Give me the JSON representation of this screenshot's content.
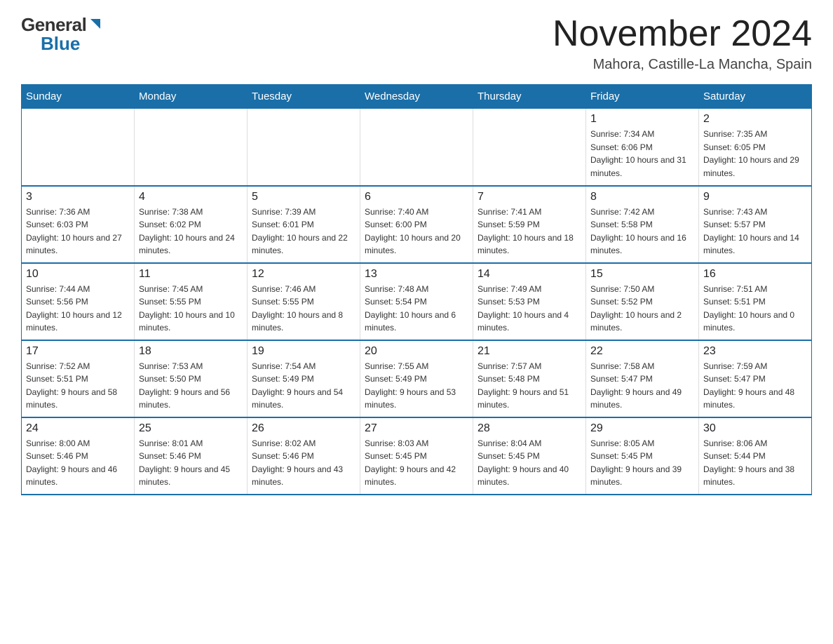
{
  "header": {
    "logo_general": "General",
    "logo_blue": "Blue",
    "month_title": "November 2024",
    "location": "Mahora, Castille-La Mancha, Spain"
  },
  "weekdays": [
    "Sunday",
    "Monday",
    "Tuesday",
    "Wednesday",
    "Thursday",
    "Friday",
    "Saturday"
  ],
  "weeks": [
    [
      {
        "day": "",
        "info": ""
      },
      {
        "day": "",
        "info": ""
      },
      {
        "day": "",
        "info": ""
      },
      {
        "day": "",
        "info": ""
      },
      {
        "day": "",
        "info": ""
      },
      {
        "day": "1",
        "info": "Sunrise: 7:34 AM\nSunset: 6:06 PM\nDaylight: 10 hours and 31 minutes."
      },
      {
        "day": "2",
        "info": "Sunrise: 7:35 AM\nSunset: 6:05 PM\nDaylight: 10 hours and 29 minutes."
      }
    ],
    [
      {
        "day": "3",
        "info": "Sunrise: 7:36 AM\nSunset: 6:03 PM\nDaylight: 10 hours and 27 minutes."
      },
      {
        "day": "4",
        "info": "Sunrise: 7:38 AM\nSunset: 6:02 PM\nDaylight: 10 hours and 24 minutes."
      },
      {
        "day": "5",
        "info": "Sunrise: 7:39 AM\nSunset: 6:01 PM\nDaylight: 10 hours and 22 minutes."
      },
      {
        "day": "6",
        "info": "Sunrise: 7:40 AM\nSunset: 6:00 PM\nDaylight: 10 hours and 20 minutes."
      },
      {
        "day": "7",
        "info": "Sunrise: 7:41 AM\nSunset: 5:59 PM\nDaylight: 10 hours and 18 minutes."
      },
      {
        "day": "8",
        "info": "Sunrise: 7:42 AM\nSunset: 5:58 PM\nDaylight: 10 hours and 16 minutes."
      },
      {
        "day": "9",
        "info": "Sunrise: 7:43 AM\nSunset: 5:57 PM\nDaylight: 10 hours and 14 minutes."
      }
    ],
    [
      {
        "day": "10",
        "info": "Sunrise: 7:44 AM\nSunset: 5:56 PM\nDaylight: 10 hours and 12 minutes."
      },
      {
        "day": "11",
        "info": "Sunrise: 7:45 AM\nSunset: 5:55 PM\nDaylight: 10 hours and 10 minutes."
      },
      {
        "day": "12",
        "info": "Sunrise: 7:46 AM\nSunset: 5:55 PM\nDaylight: 10 hours and 8 minutes."
      },
      {
        "day": "13",
        "info": "Sunrise: 7:48 AM\nSunset: 5:54 PM\nDaylight: 10 hours and 6 minutes."
      },
      {
        "day": "14",
        "info": "Sunrise: 7:49 AM\nSunset: 5:53 PM\nDaylight: 10 hours and 4 minutes."
      },
      {
        "day": "15",
        "info": "Sunrise: 7:50 AM\nSunset: 5:52 PM\nDaylight: 10 hours and 2 minutes."
      },
      {
        "day": "16",
        "info": "Sunrise: 7:51 AM\nSunset: 5:51 PM\nDaylight: 10 hours and 0 minutes."
      }
    ],
    [
      {
        "day": "17",
        "info": "Sunrise: 7:52 AM\nSunset: 5:51 PM\nDaylight: 9 hours and 58 minutes."
      },
      {
        "day": "18",
        "info": "Sunrise: 7:53 AM\nSunset: 5:50 PM\nDaylight: 9 hours and 56 minutes."
      },
      {
        "day": "19",
        "info": "Sunrise: 7:54 AM\nSunset: 5:49 PM\nDaylight: 9 hours and 54 minutes."
      },
      {
        "day": "20",
        "info": "Sunrise: 7:55 AM\nSunset: 5:49 PM\nDaylight: 9 hours and 53 minutes."
      },
      {
        "day": "21",
        "info": "Sunrise: 7:57 AM\nSunset: 5:48 PM\nDaylight: 9 hours and 51 minutes."
      },
      {
        "day": "22",
        "info": "Sunrise: 7:58 AM\nSunset: 5:47 PM\nDaylight: 9 hours and 49 minutes."
      },
      {
        "day": "23",
        "info": "Sunrise: 7:59 AM\nSunset: 5:47 PM\nDaylight: 9 hours and 48 minutes."
      }
    ],
    [
      {
        "day": "24",
        "info": "Sunrise: 8:00 AM\nSunset: 5:46 PM\nDaylight: 9 hours and 46 minutes."
      },
      {
        "day": "25",
        "info": "Sunrise: 8:01 AM\nSunset: 5:46 PM\nDaylight: 9 hours and 45 minutes."
      },
      {
        "day": "26",
        "info": "Sunrise: 8:02 AM\nSunset: 5:46 PM\nDaylight: 9 hours and 43 minutes."
      },
      {
        "day": "27",
        "info": "Sunrise: 8:03 AM\nSunset: 5:45 PM\nDaylight: 9 hours and 42 minutes."
      },
      {
        "day": "28",
        "info": "Sunrise: 8:04 AM\nSunset: 5:45 PM\nDaylight: 9 hours and 40 minutes."
      },
      {
        "day": "29",
        "info": "Sunrise: 8:05 AM\nSunset: 5:45 PM\nDaylight: 9 hours and 39 minutes."
      },
      {
        "day": "30",
        "info": "Sunrise: 8:06 AM\nSunset: 5:44 PM\nDaylight: 9 hours and 38 minutes."
      }
    ]
  ]
}
